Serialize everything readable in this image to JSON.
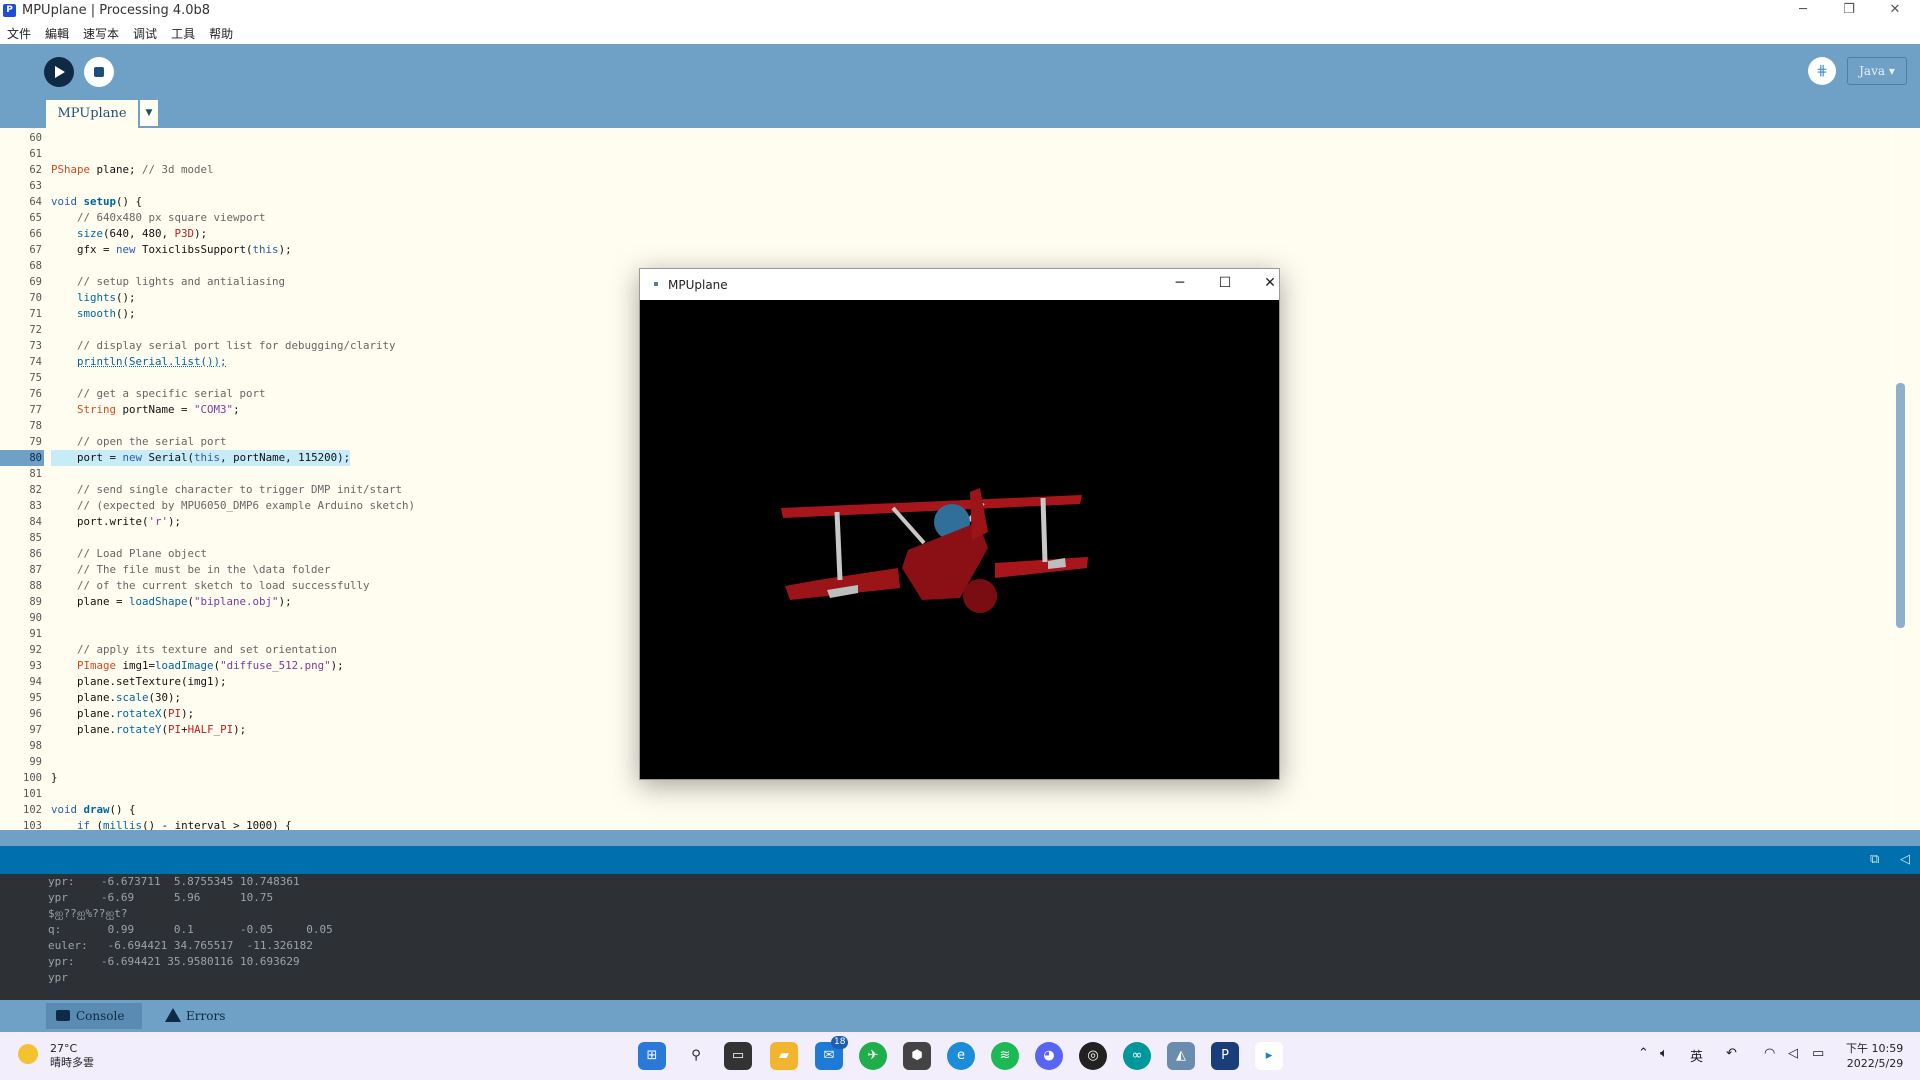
{
  "window": {
    "title": "MPUplane | Processing 4.0b8"
  },
  "menu": [
    "文件",
    "編輯",
    "速写本",
    "调试",
    "工具",
    "帮助"
  ],
  "toolbar": {
    "mode": "Java ▾"
  },
  "tabs": [
    {
      "label": "MPUplane"
    }
  ],
  "editor": {
    "lines": [
      {
        "n": "60",
        "html": ""
      },
      {
        "n": "61",
        "html": ""
      },
      {
        "n": "62",
        "html": "<span class='ty'>PShape</span> plane; <span class='cm'>// 3d model</span>"
      },
      {
        "n": "63",
        "html": ""
      },
      {
        "n": "64",
        "html": "<span class='kw'>void</span> <span class='fn'><b>setup</b></span>() {"
      },
      {
        "n": "65",
        "html": "    <span class='cm'>// 640x480 px square viewport</span>"
      },
      {
        "n": "66",
        "html": "    <span class='fn'>size</span>(640, 480, <span class='cn'>P3D</span>);"
      },
      {
        "n": "67",
        "html": "    gfx = <span class='kw'>new</span> ToxiclibsSupport(<span class='kw'>this</span>);"
      },
      {
        "n": "68",
        "html": ""
      },
      {
        "n": "69",
        "html": "    <span class='cm'>// setup lights and antialiasing</span>"
      },
      {
        "n": "70",
        "html": "    <span class='fn'>lights</span>();"
      },
      {
        "n": "71",
        "html": "    <span class='fn'>smooth</span>();"
      },
      {
        "n": "72",
        "html": ""
      },
      {
        "n": "73",
        "html": "    <span class='cm'>// display serial port list for debugging/clarity</span>"
      },
      {
        "n": "74",
        "html": "    <span class='fn' style='text-decoration:underline dotted'>println(Serial.list());</span>"
      },
      {
        "n": "75",
        "html": ""
      },
      {
        "n": "76",
        "html": "    <span class='cm'>// get a specific serial port</span>"
      },
      {
        "n": "77",
        "html": "    <span class='ty'>String</span> portName = <span class='st'>\"COM3\"</span>;"
      },
      {
        "n": "78",
        "html": ""
      },
      {
        "n": "79",
        "html": "    <span class='cm'>// open the serial port</span>"
      },
      {
        "n": "80",
        "html": "    port = <span class='kw'>new</span> Serial(<span class='kw'>this</span>, portName, 115200);",
        "current": true
      },
      {
        "n": "81",
        "html": ""
      },
      {
        "n": "82",
        "html": "    <span class='cm'>// send single character to trigger DMP init/start</span>"
      },
      {
        "n": "83",
        "html": "    <span class='cm'>// (expected by MPU6050_DMP6 example Arduino sketch)</span>"
      },
      {
        "n": "84",
        "html": "    port.write(<span class='st'>'r'</span>);"
      },
      {
        "n": "85",
        "html": ""
      },
      {
        "n": "86",
        "html": "    <span class='cm'>// Load Plane object</span>"
      },
      {
        "n": "87",
        "html": "    <span class='cm'>// The file must be in the \\data folder</span>"
      },
      {
        "n": "88",
        "html": "    <span class='cm'>// of the current sketch to load successfully</span>"
      },
      {
        "n": "89",
        "html": "    plane = <span class='fn'>loadShape</span>(<span class='st'>\"biplane.obj\"</span>);"
      },
      {
        "n": "90",
        "html": ""
      },
      {
        "n": "91",
        "html": ""
      },
      {
        "n": "92",
        "html": "    <span class='cm'>// apply its texture and set orientation</span>"
      },
      {
        "n": "93",
        "html": "    <span class='ty'>PImage</span> img1=<span class='fn'>loadImage</span>(<span class='st'>\"diffuse_512.png\"</span>);"
      },
      {
        "n": "94",
        "html": "    plane.setTexture(img1);"
      },
      {
        "n": "95",
        "html": "    plane.<span class='fn'>scale</span>(30);"
      },
      {
        "n": "96",
        "html": "    plane.<span class='fn'>rotateX</span>(<span class='cn'>PI</span>);"
      },
      {
        "n": "97",
        "html": "    plane.<span class='fn'>rotateY</span>(<span class='cn'>PI</span>+<span class='cn'>HALF_PI</span>);"
      },
      {
        "n": "98",
        "html": ""
      },
      {
        "n": "99",
        "html": ""
      },
      {
        "n": "100",
        "html": "}"
      },
      {
        "n": "101",
        "html": ""
      },
      {
        "n": "102",
        "html": "<span class='kw'>void</span> <span class='fn'><b>draw</b></span>() {"
      },
      {
        "n": "103",
        "html": "    <span class='kw'>if</span> (<span class='fn'>millis</span>() - interval &gt; 1000) {"
      }
    ]
  },
  "console": {
    "lines": [
      "ypr:    -6.673711  5.8755345 10.748361",
      "ypr     -6.69      5.96      10.75",
      "$ஐ??ஐ%??ஐt?",
      "q:       0.99      0.1       -0.05     0.05",
      "euler:   -6.694421 34.765517  -11.326182",
      "ypr:    -6.694421 35.9580116 10.693629",
      "ypr"
    ]
  },
  "console_tabs": {
    "console": "Console",
    "errors": "Errors"
  },
  "sketch_window": {
    "title": "MPUplane"
  },
  "taskbar": {
    "weather_temp": "27°C",
    "weather_desc": "晴時多雲",
    "mail_badge": "18",
    "ime": "英",
    "time": "下午 10:59",
    "date": "2022/5/29"
  },
  "colors": {
    "accent": "#6fa0c6",
    "editor_bg": "#fffdf0",
    "console_bg": "#2d3136",
    "plane_red": "#a8161b"
  }
}
